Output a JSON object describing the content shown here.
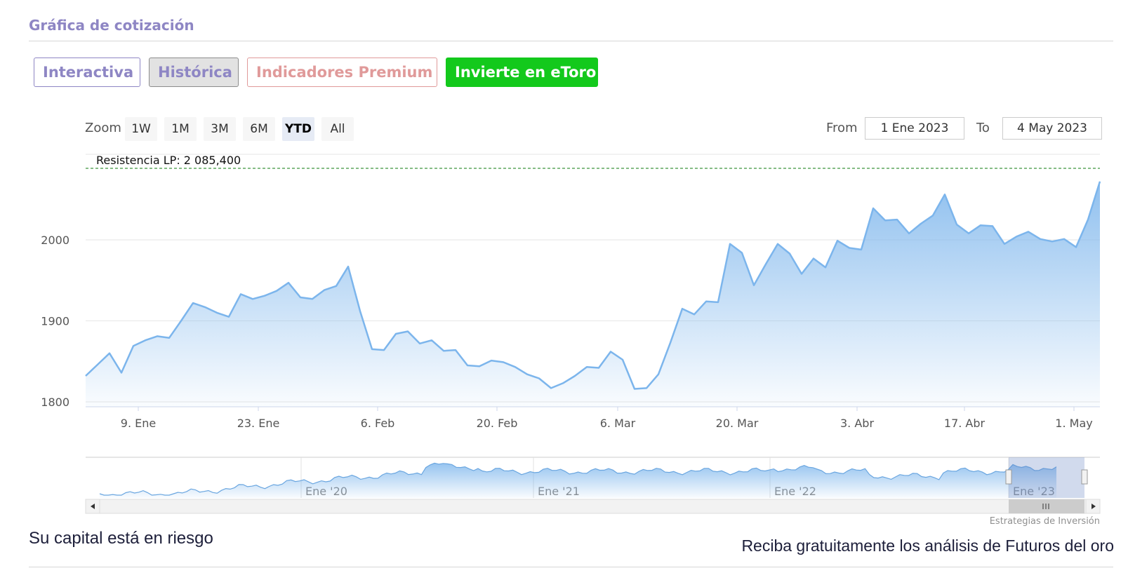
{
  "section_title": "Gráfica de cotización",
  "tabs": [
    {
      "label": "Interactiva"
    },
    {
      "label": "Histórica"
    },
    {
      "label": "Indicadores Premium"
    },
    {
      "label": "Invierte en eToro"
    }
  ],
  "zoom": {
    "label": "Zoom",
    "buttons": [
      "1W",
      "1M",
      "3M",
      "6M",
      "YTD",
      "All"
    ],
    "active": "YTD"
  },
  "range": {
    "from_label": "From",
    "from_value": "1 Ene 2023",
    "to_label": "To",
    "to_value": "4 May 2023"
  },
  "footer": {
    "risk": "Su capital está en riesgo",
    "cta": "Reciba gratuitamente los análisis de Futuros del oro",
    "credit": "Estrategias de Inversión"
  },
  "colors": {
    "line": "#7cb5ec",
    "tab_accent": "#8e86c4",
    "premium": "#e09a9a",
    "etoro": "#13c91c",
    "resistance": "#0b7a0b"
  },
  "chart_data": {
    "type": "area",
    "title": "",
    "ylim": [
      1800,
      2090
    ],
    "y_ticks": [
      1800,
      1900,
      2000
    ],
    "x_ticks": [
      "9. Ene",
      "23. Ene",
      "6. Feb",
      "20. Feb",
      "6. Mar",
      "20. Mar",
      "3. Abr",
      "17. Abr",
      "1. May"
    ],
    "resistance": {
      "label": "Resistencia LP: 2 085,400",
      "value": 2085.4
    },
    "series": [
      {
        "values": [
          1832,
          1846,
          1860,
          1836,
          1869,
          1876,
          1881,
          1879,
          1900,
          1922,
          1917,
          1910,
          1905,
          1933,
          1927,
          1931,
          1937,
          1947,
          1929,
          1927,
          1938,
          1943,
          1967,
          1912,
          1865,
          1864,
          1884,
          1887,
          1872,
          1876,
          1863,
          1864,
          1845,
          1844,
          1851,
          1849,
          1843,
          1834,
          1829,
          1817,
          1823,
          1832,
          1843,
          1842,
          1862,
          1852,
          1816,
          1817,
          1834,
          1873,
          1915,
          1908,
          1924,
          1923,
          1995,
          1984,
          1944,
          1970,
          1995,
          1983,
          1958,
          1977,
          1966,
          1999,
          1990,
          1988,
          2039,
          2024,
          2025,
          2008,
          2020,
          2030,
          2056,
          2019,
          2008,
          2018,
          2017,
          1995,
          2004,
          2010,
          2001,
          1998,
          2001,
          1991,
          2025,
          2072
        ]
      }
    ],
    "navigator": {
      "x_ticks": [
        "Ene '20",
        "Ene '21",
        "Ene '22",
        "Ene '23"
      ]
    },
    "grid": true,
    "legend": "none"
  }
}
